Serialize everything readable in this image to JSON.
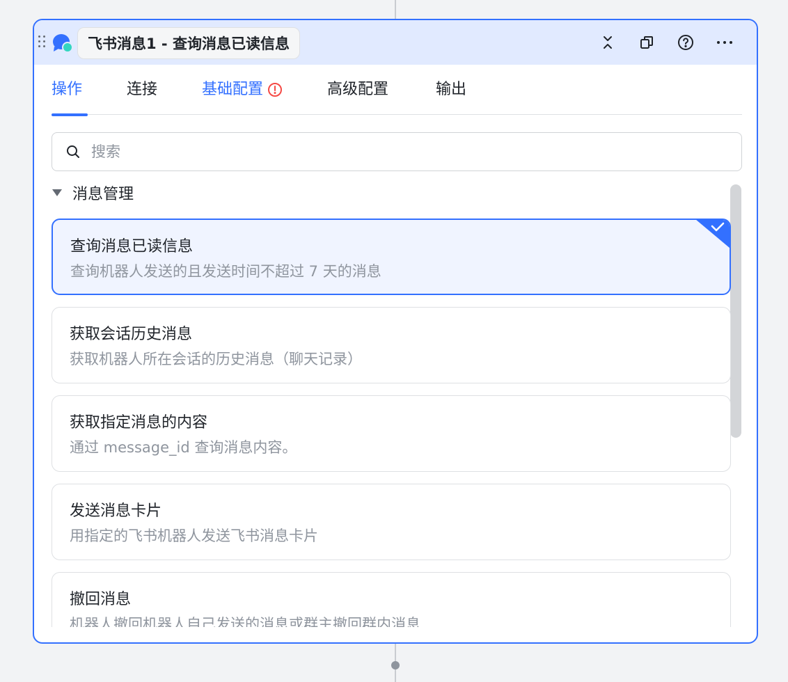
{
  "header": {
    "title": "飞书消息1 - 查询消息已读信息"
  },
  "tabs": [
    {
      "label": "操作"
    },
    {
      "label": "连接"
    },
    {
      "label": "基础配置"
    },
    {
      "label": "高级配置"
    },
    {
      "label": "输出"
    }
  ],
  "search": {
    "placeholder": "搜索",
    "value": ""
  },
  "group": {
    "label": "消息管理"
  },
  "operations": [
    {
      "title": "查询消息已读信息",
      "desc": "查询机器人发送的且发送时间不超过 7 天的消息"
    },
    {
      "title": "获取会话历史消息",
      "desc": "获取机器人所在会话的历史消息（聊天记录）"
    },
    {
      "title": "获取指定消息的内容",
      "desc": "通过 message_id 查询消息内容。"
    },
    {
      "title": "发送消息卡片",
      "desc": "用指定的飞书机器人发送飞书消息卡片"
    },
    {
      "title": "撤回消息",
      "desc": "机器人撤回机器人自己发送的消息或群主撤回群内消息"
    }
  ],
  "colors": {
    "accent": "#3370ff",
    "header_bg": "#e1eaff",
    "selected_bg": "#f0f4ff",
    "warning": "#f54a45",
    "logo_teal": "#33d6c0"
  },
  "icons": {
    "drag": "drag-handle-icon",
    "logo": "feishu-message-logo-icon",
    "collapse": "collapse-icon",
    "copy": "copy-icon",
    "help": "help-circle-icon",
    "more": "more-horizontal-icon",
    "warn": "warning-circle-icon",
    "search": "search-icon",
    "caret": "caret-down-icon",
    "check": "check-icon"
  }
}
